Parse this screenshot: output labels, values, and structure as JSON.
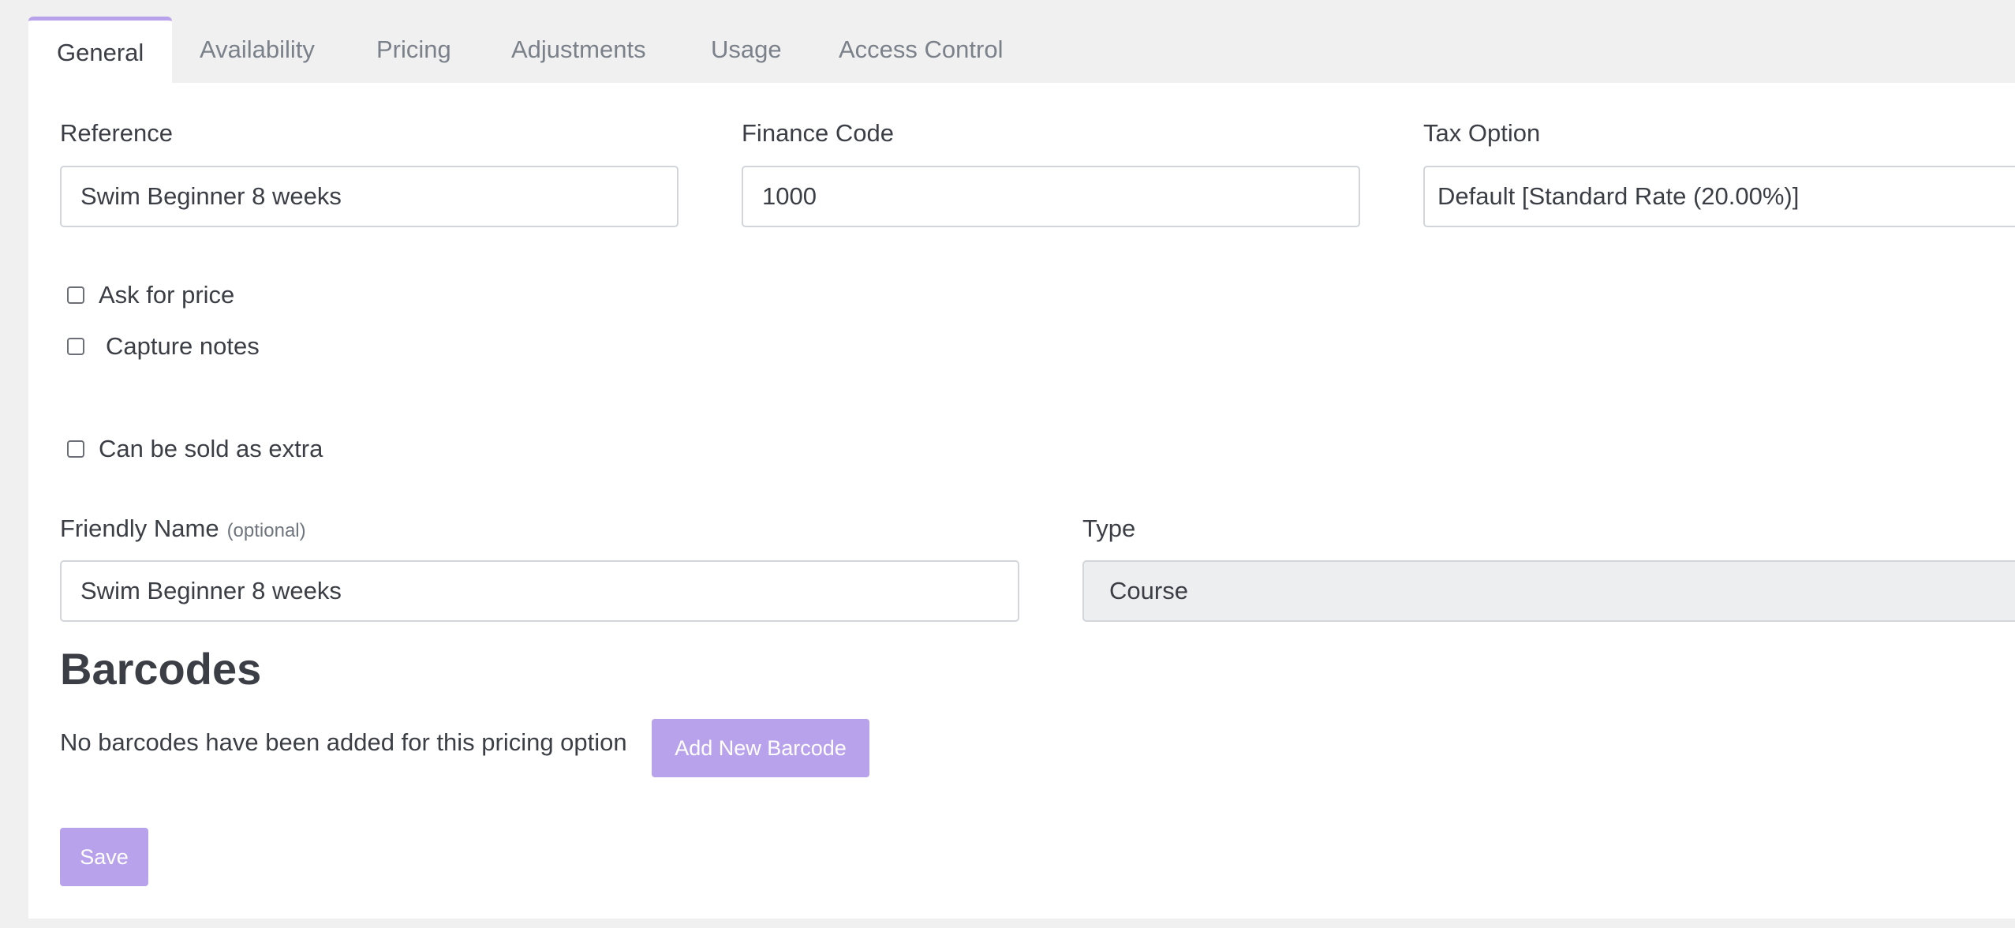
{
  "tabs": [
    {
      "label": "General",
      "active": true
    },
    {
      "label": "Availability"
    },
    {
      "label": "Pricing"
    },
    {
      "label": "Adjustments"
    },
    {
      "label": "Usage"
    },
    {
      "label": "Access Control"
    }
  ],
  "form": {
    "reference": {
      "label": "Reference",
      "value": "Swim Beginner 8 weeks"
    },
    "finance_code": {
      "label": "Finance Code",
      "value": "1000"
    },
    "tax_option": {
      "label": "Tax Option",
      "value": "Default [Standard Rate (20.00%)]"
    },
    "checkboxes": {
      "ask_for_price": {
        "label": "Ask for price",
        "checked": false
      },
      "capture_notes": {
        "label": "Capture notes",
        "checked": false
      },
      "sold_as_extra": {
        "label": "Can be sold as extra",
        "checked": false
      }
    },
    "friendly_name": {
      "label": "Friendly Name",
      "optional": "(optional)",
      "value": "Swim Beginner 8 weeks"
    },
    "type": {
      "label": "Type",
      "value": "Course"
    }
  },
  "barcodes": {
    "heading": "Barcodes",
    "empty_text": "No barcodes have been added for this pricing option",
    "add_button": "Add New Barcode"
  },
  "actions": {
    "save": "Save"
  },
  "colors": {
    "accent": "#b9a2ec",
    "page_bg": "#f0f0f0",
    "readonly_bg": "#eceef0"
  }
}
